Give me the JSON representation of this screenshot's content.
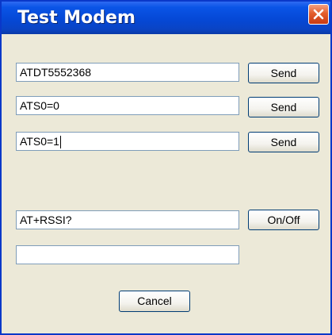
{
  "window": {
    "title": "Test Modem"
  },
  "commands": [
    {
      "value": "ATDT5552368",
      "button": "Send"
    },
    {
      "value": "ATS0=0",
      "button": "Send"
    },
    {
      "value": "ATS0=1",
      "button": "Send"
    }
  ],
  "rssi": {
    "value": "AT+RSSI?",
    "button": "On/Off",
    "response": ""
  },
  "footer": {
    "cancel_label": "Cancel"
  },
  "icons": {
    "close": "close-icon"
  },
  "colors": {
    "titlebar": "#0548d6",
    "close_button": "#e35e2c",
    "dialog_background": "#ece9d8"
  }
}
